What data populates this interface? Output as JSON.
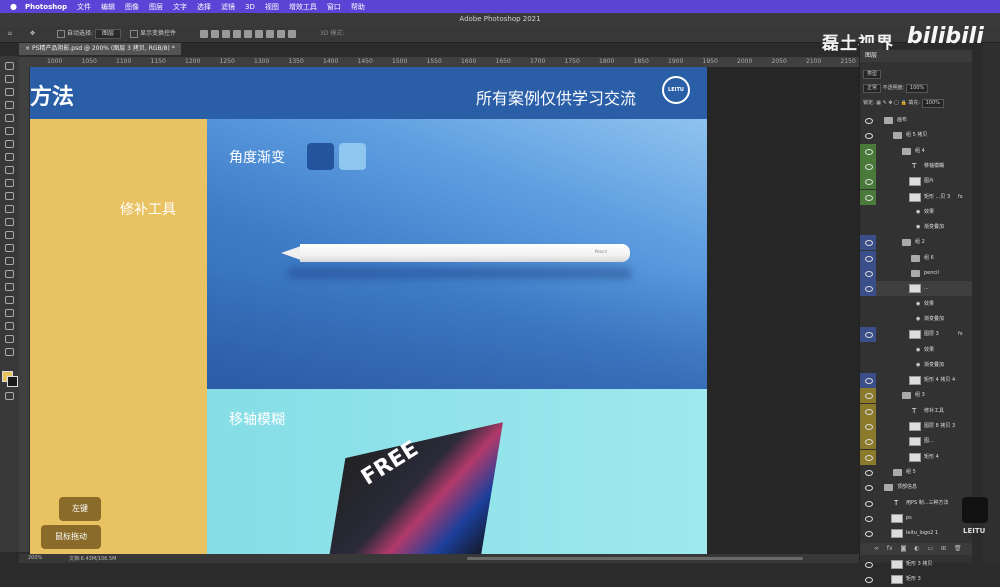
{
  "menubar": {
    "app": "Photoshop",
    "items": [
      "文件",
      "编辑",
      "图像",
      "图层",
      "文字",
      "选择",
      "滤镜",
      "3D",
      "视图",
      "增效工具",
      "窗口",
      "帮助"
    ]
  },
  "window": {
    "title": "Adobe Photoshop 2021"
  },
  "options_bar": {
    "auto_select_label": "自动选择:",
    "auto_select_value": "图层",
    "transform_label": "显示变换控件",
    "mode_3d": "3D 模式:"
  },
  "watermark": {
    "text": "磊土视界",
    "logo": "bilibili"
  },
  "document_tab": {
    "label": "PS精产品阴影.psd @ 200% (图层 3 拷贝, RGB/8) *"
  },
  "ruler": {
    "h_labels": [
      "1000",
      "1050",
      "1100",
      "1150",
      "1200",
      "1250",
      "1300",
      "1350",
      "1400",
      "1450",
      "1500",
      "1550",
      "1600",
      "1650",
      "1700",
      "1750",
      "1800",
      "1850",
      "1900",
      "1950",
      "2000",
      "2050",
      "2100",
      "2150"
    ]
  },
  "canvas": {
    "header_left": "方法",
    "header_right": "所有案例仅供学习交流",
    "logo": "LEITU",
    "section1_label": "修补工具",
    "section2_label": "角度渐变",
    "section3_label": "移轴模糊",
    "button_left": "左键",
    "button_drag": "鼠标拖动",
    "pencil_brand": " Pencil",
    "card_text": "FREE",
    "colors": {
      "blue": "#2a5fa8",
      "yellow": "#e9c261",
      "teal": "#8fe3ea",
      "swatch_dark": "#24549c",
      "swatch_light": "#8fc6f0"
    }
  },
  "status": {
    "zoom": "200%",
    "doc": "文档:6.43M/106.5M"
  },
  "layers_panel": {
    "title": "图层",
    "filter_type": "类型",
    "blend_mode": "正常",
    "opacity_label": "不透明度:",
    "opacity_value": "100%",
    "lock_label": "锁定:",
    "fill_label": "填充:",
    "fill_value": "100%",
    "layers": [
      {
        "name": "画布",
        "kind": "folder",
        "indent": 0,
        "color": ""
      },
      {
        "name": "组 5 拷贝",
        "kind": "folder",
        "indent": 1,
        "color": ""
      },
      {
        "name": "组 4",
        "kind": "folder",
        "indent": 2,
        "color": "#4a7a3a"
      },
      {
        "name": "移轴模糊",
        "kind": "text",
        "indent": 3,
        "color": "#4a7a3a"
      },
      {
        "name": "图片",
        "kind": "pixel",
        "indent": 3,
        "color": "#4a7a3a"
      },
      {
        "name": "矩形 ...贝 3",
        "kind": "pixel",
        "indent": 3,
        "color": "#4a7a3a",
        "fx": "fx"
      },
      {
        "name": "效果",
        "kind": "fx",
        "indent": 4,
        "color": "#4a7a3a"
      },
      {
        "name": "渐变叠加",
        "kind": "fx",
        "indent": 4,
        "color": "#4a7a3a"
      },
      {
        "name": "组 2",
        "kind": "folder",
        "indent": 2,
        "color": "#3a4f8a"
      },
      {
        "name": "组 6",
        "kind": "folder",
        "indent": 3,
        "color": "#3a4f8a"
      },
      {
        "name": "pencil",
        "kind": "folder",
        "indent": 3,
        "color": "#3a4f8a"
      },
      {
        "name": "...",
        "kind": "pixel",
        "indent": 3,
        "color": "#3a4f8a",
        "sel": true
      },
      {
        "name": "效果",
        "kind": "fx",
        "indent": 4,
        "color": "#3a4f8a"
      },
      {
        "name": "渐变叠加",
        "kind": "fx",
        "indent": 4,
        "color": "#3a4f8a"
      },
      {
        "name": "图层 3",
        "kind": "pixel",
        "indent": 3,
        "color": "#3a4f8a",
        "fx": "fx"
      },
      {
        "name": "效果",
        "kind": "fx",
        "indent": 4,
        "color": "#3a4f8a"
      },
      {
        "name": "渐变叠加",
        "kind": "fx",
        "indent": 4,
        "color": "#3a4f8a"
      },
      {
        "name": "矩形 4 拷贝 4",
        "kind": "pixel",
        "indent": 3,
        "color": "#3a4f8a"
      },
      {
        "name": "组 3",
        "kind": "folder",
        "indent": 2,
        "color": "#8a7a2a"
      },
      {
        "name": "修补工具",
        "kind": "text",
        "indent": 3,
        "color": "#8a7a2a"
      },
      {
        "name": "图层 8 拷贝 3",
        "kind": "pixel",
        "indent": 3,
        "color": "#8a7a2a"
      },
      {
        "name": "图...",
        "kind": "pixel",
        "indent": 3,
        "color": "#8a7a2a"
      },
      {
        "name": "矩形 4",
        "kind": "pixel",
        "indent": 3,
        "color": "#8a7a2a"
      },
      {
        "name": "组 5",
        "kind": "folder",
        "indent": 1,
        "color": ""
      },
      {
        "name": "顶部信息",
        "kind": "folder",
        "indent": 0,
        "color": ""
      },
      {
        "name": "用PS 制...三种方法",
        "kind": "text",
        "indent": 1,
        "color": ""
      },
      {
        "name": "ps",
        "kind": "pixel",
        "indent": 1,
        "color": ""
      },
      {
        "name": "leitu_logo2 1",
        "kind": "pixel",
        "indent": 1,
        "color": ""
      },
      {
        "name": "所有案例仅供学习交流",
        "kind": "text",
        "indent": 1,
        "color": ""
      },
      {
        "name": "矩形 3 拷贝",
        "kind": "pixel",
        "indent": 1,
        "color": ""
      },
      {
        "name": "矩形 3",
        "kind": "pixel",
        "indent": 1,
        "color": ""
      }
    ]
  },
  "brand_corner": {
    "text": "LEITU"
  }
}
